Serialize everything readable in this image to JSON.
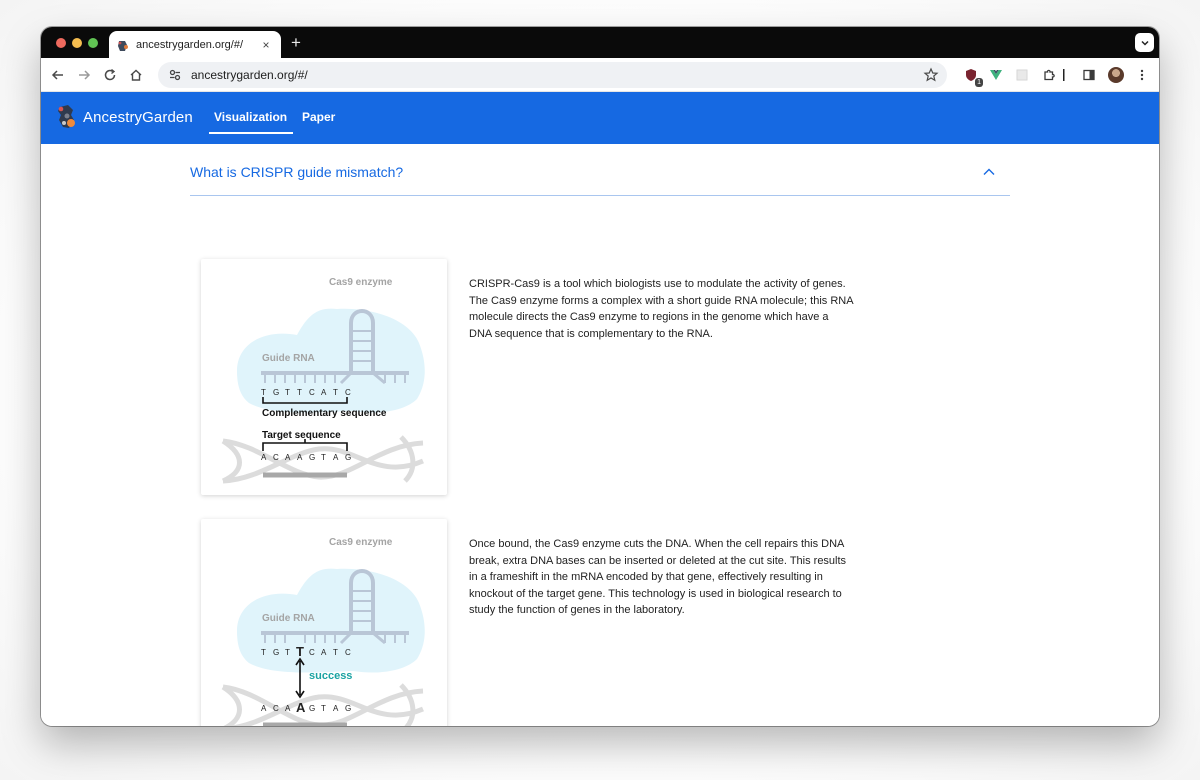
{
  "browser": {
    "tab_title": "ancestrygarden.org/#/",
    "tab_close": "×",
    "new_tab": "+",
    "url": "ancestrygarden.org/#/",
    "extension_badge": "1"
  },
  "app": {
    "brand": "AncestryGarden",
    "nav": [
      {
        "label": "Visualization",
        "active": true
      },
      {
        "label": "Paper",
        "active": false
      }
    ]
  },
  "accordion": {
    "title": "What is CRISPR guide mismatch?",
    "expanded": true
  },
  "sections": [
    {
      "figure": {
        "enzyme_label": "Cas9 enzyme",
        "guide_label": "Guide RNA",
        "guide_seq": [
          "T",
          "G",
          "T",
          "T",
          "C",
          "A",
          "T",
          "C"
        ],
        "bracket_top_label": "Complementary sequence",
        "bracket_bottom_label": "Target sequence",
        "target_seq": [
          "A",
          "C",
          "A",
          "A",
          "G",
          "T",
          "A",
          "G"
        ]
      },
      "text": "CRISPR-Cas9 is a tool which biologists use to modulate the activity of genes. The Cas9 enzyme forms a complex with a short guide RNA molecule; this RNA molecule directs the Cas9 enzyme to regions in the genome which have a DNA sequence that is complementary to the RNA."
    },
    {
      "figure": {
        "enzyme_label": "Cas9 enzyme",
        "guide_label": "Guide RNA",
        "guide_seq": [
          "T",
          "G",
          "T",
          "T",
          "C",
          "A",
          "T",
          "C"
        ],
        "target_seq": [
          "A",
          "C",
          "A",
          "A",
          "G",
          "T",
          "A",
          "G"
        ],
        "highlight_index": 3,
        "match_label": "success"
      },
      "text": "Once bound, the Cas9 enzyme cuts the DNA. When the cell repairs this DNA break, extra DNA bases can be inserted or deleted at the cut site. This results in a frameshift in the mRNA encoded by that gene, effectively resulting in knockout of the target gene. This technology is used in biological research to study the function of genes in the laboratory."
    }
  ],
  "colors": {
    "brand_blue": "#1669e2",
    "enzyme_fill": "#e0f4fb",
    "rna_stroke": "#b9c6d6",
    "dna_stroke": "#dcdcdc",
    "success": "#1aa3a3"
  }
}
